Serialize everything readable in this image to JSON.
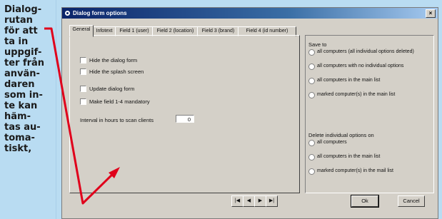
{
  "caption": {
    "text": "Dialog-\nrutan\nför att\nta in\nuppgif-\nter från\nanvän-\ndaren\nsom in-\nte kan\nhäm-\ntas au-\ntoma-\ntiskt,"
  },
  "window": {
    "title": "Dialog form options",
    "close_label": "×"
  },
  "tabs": [
    "General",
    "Infotext",
    "Field 1 (user)",
    "Field 2 (location)",
    "Field 3 (brand)",
    "Field 4 (id number)"
  ],
  "general": {
    "checkboxes": [
      "Hide the dialog form",
      "Hide the splash screen",
      "Update dialog form",
      "Make field 1-4 mandatory"
    ],
    "interval_label": "Interval in hours to scan clients",
    "interval_value": "0"
  },
  "save_to": {
    "title": "Save to",
    "options": [
      "all computers (all individual options deleted)",
      "all computers with no individual options",
      "all computers in the main list",
      "marked computer(s) in the main list"
    ]
  },
  "delete_individual": {
    "title": "Delete individual options on",
    "options": [
      "all computers",
      "all computers in the main list",
      "marked computer(s) in the mail list"
    ]
  },
  "navigation": [
    "|◀",
    "◀",
    "▶",
    "▶|"
  ],
  "buttons": {
    "ok": "Ok",
    "cancel": "Cancel"
  },
  "colors": {
    "arrow": "#e0001b",
    "title_bar": "#0a246a",
    "background": "#b9dcf2",
    "dialog": "#d4d0c8"
  }
}
